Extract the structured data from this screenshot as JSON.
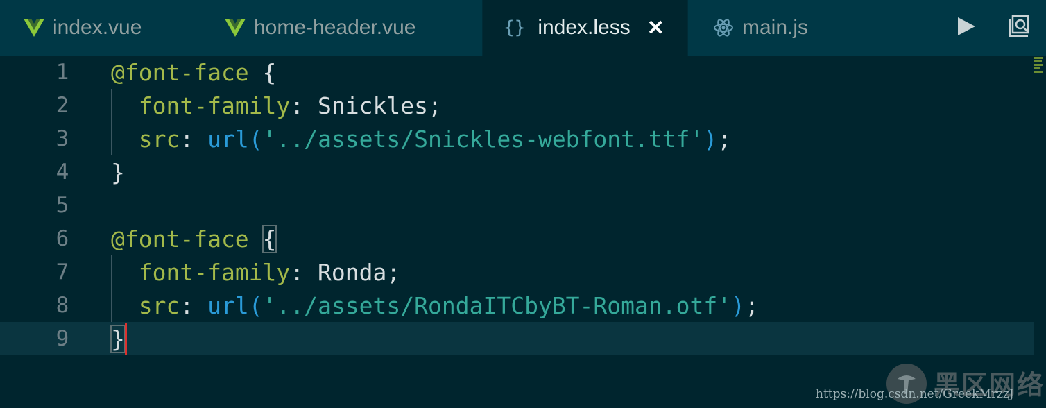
{
  "tabs": [
    {
      "label": "index.vue",
      "icon": "vue-icon"
    },
    {
      "label": "home-header.vue",
      "icon": "vue-icon"
    },
    {
      "label": "index.less",
      "icon": "braces-icon",
      "icon_text": "{}",
      "active": true,
      "close": "✕"
    },
    {
      "label": "main.js",
      "icon": "react-atom-icon"
    }
  ],
  "actions": [
    "run-play-icon",
    "search-preview-icon"
  ],
  "lines": {
    "n1": "1",
    "n2": "2",
    "n3": "3",
    "n4": "4",
    "n5": "5",
    "n6": "6",
    "n7": "7",
    "n8": "8",
    "n9": "9"
  },
  "code": {
    "l1_kw": "@font-face",
    "l1_rest": " {",
    "l2_prop": "font-family",
    "l2_colon": ": ",
    "l2_val": "Snickles;",
    "l3_prop": "src",
    "l3_colon": ": ",
    "l3_fn": "url(",
    "l3_str": "'../assets/Snickles-webfont.ttf'",
    "l3_close": ")",
    "l3_semi": ";",
    "l4": "}",
    "l6_kw": "@font-face",
    "l6_brace": "{",
    "l7_prop": "font-family",
    "l7_colon": ": ",
    "l7_val": "Ronda;",
    "l8_prop": "src",
    "l8_colon": ": ",
    "l8_fn": "url(",
    "l8_str": "'../assets/RondaITCbyBT-Roman.otf'",
    "l8_close": ")",
    "l8_semi": ";",
    "l9": "}"
  },
  "watermark": {
    "brand": "黑区网络",
    "url": "https://blog.csdn.net/GreekMrzzJ"
  },
  "colors": {
    "background": "#00252e",
    "tabbar": "#003846",
    "keyword": "#a3b94a",
    "function": "#2a9bd8",
    "string": "#35a99a",
    "cursor": "#dc322f"
  }
}
